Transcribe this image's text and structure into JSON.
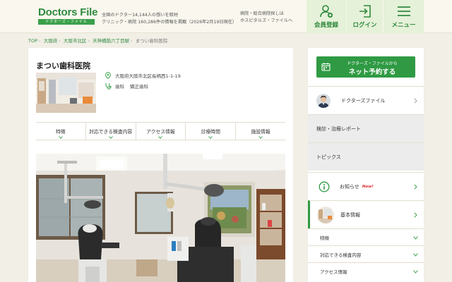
{
  "header": {
    "logo_main": "Doctors File",
    "logo_sub": "ドクターズ・ファイル",
    "tagline_1": "全国のドクター14,144人の想いを取材",
    "tagline_2": "クリニック・病院 160,286件の情報を掲載（2026年2月19日現在）",
    "hospital_link_1": "病院・総合病院探しは",
    "hospital_link_2": "ホスピタルズ・ファイルへ",
    "member_label": "会員登録",
    "login_label": "ログイン",
    "menu_label": "メニュー"
  },
  "breadcrumb": [
    "TOP",
    "大阪府",
    "大阪市北区",
    "天神橋筋六丁目駅",
    "まつい歯科医院"
  ],
  "clinic": {
    "name": "まつい歯科医院",
    "address": "大阪府大阪市北区長柄西1-1-19",
    "departments": [
      "歯科",
      "矯正歯科"
    ]
  },
  "tabs": [
    "特徴",
    "対応できる検査内容",
    "アクセス情報",
    "診療時間",
    "施設情報"
  ],
  "sidebar": {
    "reserve_small": "ドクターズ・ファイルから",
    "reserve_big": "ネット予約する",
    "doctors_file": "ドクターズファイル",
    "exam_report": "検診・治療レポート",
    "topics": "トピックス",
    "news": "お知らせ",
    "news_badge": "New!",
    "basic_info": "基本情報",
    "sub_features": "特徴",
    "sub_exam": "対応できる検査内容",
    "sub_access": "アクセス情報"
  },
  "colors": {
    "brand_green": "#2f8a3e",
    "button_green": "#2f9a43",
    "header_tint": "#e5f1d8",
    "page_bg": "#f1efe6"
  }
}
